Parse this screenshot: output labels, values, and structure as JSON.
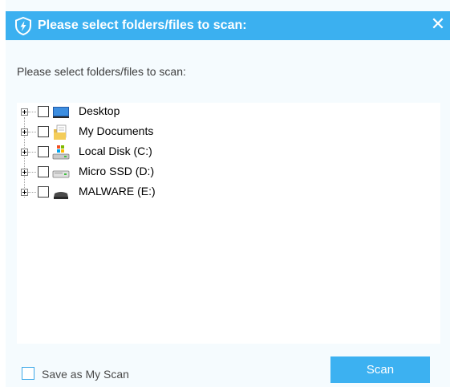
{
  "window": {
    "title": "Please select folders/files to scan:",
    "close_glyph": "✕",
    "accent_color": "#3bb0f0"
  },
  "subtitle": "Please select folders/files to scan:",
  "tree": {
    "items": [
      {
        "label": "Desktop",
        "icon": "desktop-icon",
        "checked": false
      },
      {
        "label": "My Documents",
        "icon": "documents-folder-icon",
        "checked": false
      },
      {
        "label": "Local Disk (C:)",
        "icon": "system-drive-icon",
        "checked": false
      },
      {
        "label": "Micro SSD (D:)",
        "icon": "removable-drive-icon",
        "checked": false
      },
      {
        "label": "MALWARE (E:)",
        "icon": "usb-drive-icon",
        "checked": false
      }
    ]
  },
  "footer": {
    "save_label": "Save as My Scan",
    "save_checked": false,
    "scan_label": "Scan"
  }
}
